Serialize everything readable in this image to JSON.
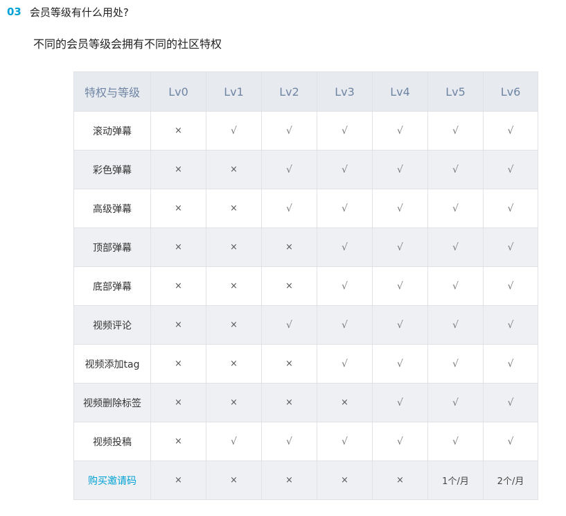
{
  "question": {
    "number": "03",
    "title": "会员等级有什么用处?"
  },
  "answer": "不同的会员等级会拥有不同的社区特权",
  "table": {
    "header_label": "特权与等级",
    "levels": [
      "Lv0",
      "Lv1",
      "Lv2",
      "Lv3",
      "Lv4",
      "Lv5",
      "Lv6"
    ],
    "rows": [
      {
        "feature": "滚动弹幕",
        "values": [
          "×",
          "√",
          "√",
          "√",
          "√",
          "√",
          "√"
        ]
      },
      {
        "feature": "彩色弹幕",
        "values": [
          "×",
          "×",
          "√",
          "√",
          "√",
          "√",
          "√"
        ]
      },
      {
        "feature": "高级弹幕",
        "values": [
          "×",
          "×",
          "√",
          "√",
          "√",
          "√",
          "√"
        ]
      },
      {
        "feature": "顶部弹幕",
        "values": [
          "×",
          "×",
          "×",
          "√",
          "√",
          "√",
          "√"
        ]
      },
      {
        "feature": "底部弹幕",
        "values": [
          "×",
          "×",
          "×",
          "√",
          "√",
          "√",
          "√"
        ]
      },
      {
        "feature": "视频评论",
        "values": [
          "×",
          "×",
          "√",
          "√",
          "√",
          "√",
          "√"
        ]
      },
      {
        "feature": "视频添加tag",
        "values": [
          "×",
          "×",
          "×",
          "√",
          "√",
          "√",
          "√"
        ]
      },
      {
        "feature": "视频删除标签",
        "values": [
          "×",
          "×",
          "×",
          "×",
          "√",
          "√",
          "√"
        ]
      },
      {
        "feature": "视频投稿",
        "values": [
          "×",
          "√",
          "√",
          "√",
          "√",
          "√",
          "√"
        ]
      },
      {
        "feature": "购买邀请码",
        "link": true,
        "values": [
          "×",
          "×",
          "×",
          "×",
          "×",
          "1个/月",
          "2个/月"
        ]
      }
    ]
  },
  "colors": {
    "accent": "#00a1d6",
    "header_bg": "#e7ebf0",
    "header_text": "#6f84a3",
    "stripe_bg": "#eef0f3",
    "border": "#dfe3e8"
  }
}
